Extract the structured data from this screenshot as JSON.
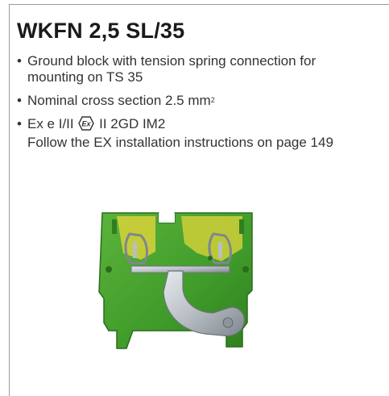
{
  "product": {
    "title": "WKFN 2,5 SL/35",
    "bullet_char": "•",
    "bullets": {
      "b1_line1": "Ground block with tension spring connection for",
      "b1_line2": "mounting on TS 35",
      "b2_text": "Nominal cross section 2.5 mm",
      "b2_sup": "2",
      "b3_before": "Ex e I/II",
      "b3_after": "II 2GD IM2",
      "b3_line2": "Follow the EX installation instructions on page 149"
    },
    "ex_symbol_label": "Ex"
  },
  "colors": {
    "terminal_green": "#3f9b2a",
    "terminal_yellow": "#d8d23a",
    "metal": "#b8bec4"
  }
}
